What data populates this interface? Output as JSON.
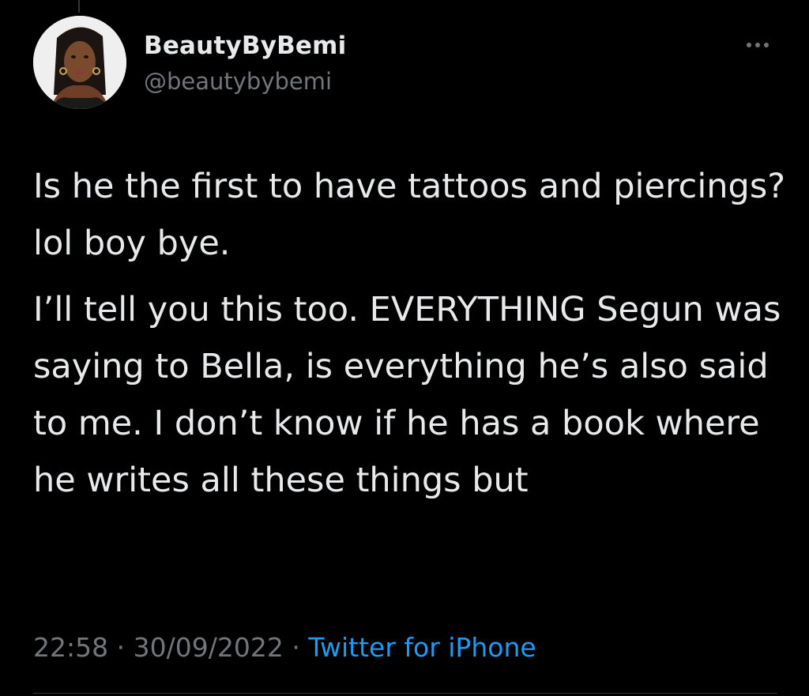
{
  "tweet": {
    "author": {
      "display_name": "BeautyByBemi",
      "handle": "@beautybybemi",
      "avatar_icon": "profile-photo"
    },
    "more_icon": "more-dots-icon",
    "paragraphs": [
      "Is he the first to have tattoos and piercings? lol boy bye.",
      "I’ll tell you this too. EVERYTHING Segun was saying to Bella, is everything he’s also said to me. I don’t know if he has a book where he writes all these things but"
    ],
    "time": "22:58",
    "separator": "·",
    "date": "30/09/2022",
    "source": "Twitter for iPhone"
  },
  "colors": {
    "background": "#000000",
    "text": "#e7e9ea",
    "muted": "#71767b",
    "link": "#1d9bf0"
  }
}
